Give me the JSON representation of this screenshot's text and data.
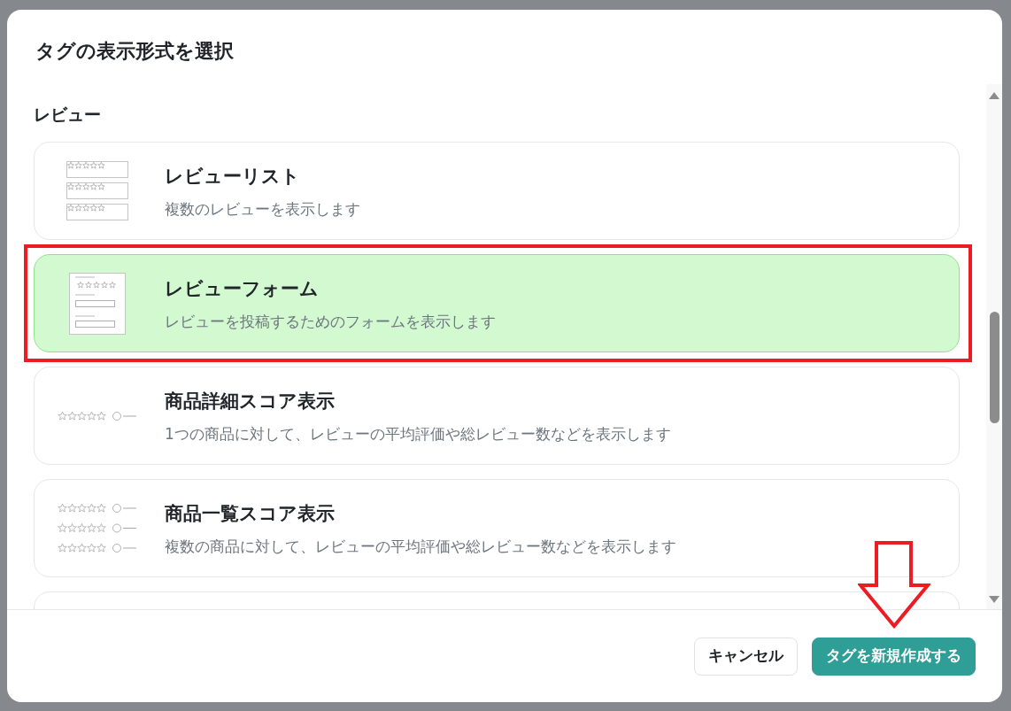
{
  "dialog": {
    "title": "タグの表示形式を選択"
  },
  "sections": [
    {
      "heading": "レビュー",
      "items": [
        {
          "kind": "list",
          "title": "レビューリスト",
          "description": "複数のレビューを表示します",
          "selected": false,
          "highlighted": false
        },
        {
          "kind": "form",
          "title": "レビューフォーム",
          "description": "レビューを投稿するためのフォームを表示します",
          "selected": true,
          "highlighted": true
        },
        {
          "kind": "score",
          "title": "商品詳細スコア表示",
          "description": "1つの商品に対して、レビューの平均評価や総レビュー数などを表示します",
          "selected": false,
          "highlighted": false
        },
        {
          "kind": "score_list",
          "title": "商品一覧スコア表示",
          "description": "複数の商品に対して、レビューの平均評価や総レビュー数などを表示します",
          "selected": false,
          "highlighted": false
        }
      ]
    }
  ],
  "buttons": [
    {
      "kind": "secondary",
      "label": "キャンセル",
      "highlighted": false
    },
    {
      "kind": "primary",
      "label": "タグを新規作成する",
      "highlighted": true
    }
  ]
}
